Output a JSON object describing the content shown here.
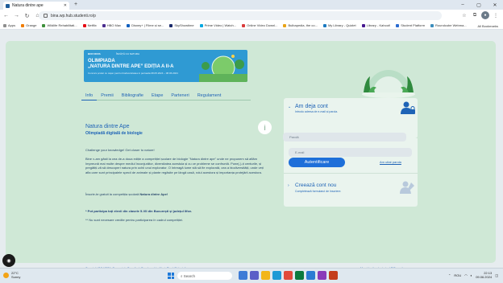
{
  "browser": {
    "tab_title": "Natura dintre ape",
    "new_tab": "+",
    "url": "bina.wp.hub.studenti.ro/p",
    "bookmarks": [
      "Apps",
      "Orange",
      "Wildlife Rehabilitati...",
      "Netflix",
      "HBO Max",
      "Disney+ | Filme și se...",
      "SkyShowtime",
      "Prime Video | Watch...",
      "Online Video Downl...",
      "Bulbapedia, the co...",
      "My Library - Quizlet",
      "Library - Kahoot!",
      "Student Platform",
      "Roundcube Webma..."
    ],
    "all_bookmarks": "All Bookmarks"
  },
  "banner": {
    "brand_left": "BCR NOVA",
    "brand_right": "ÎNVĂȚĂ CU NATURA",
    "title_line1": "OLIMPIADA",
    "title_line2": "„NATURA DINTRE APE” EDIȚIA A II-A",
    "subtitle": "Concurs școlar cu caper pentru biodiversitatea in perioada 08.05.2024 – 08.06.2024"
  },
  "nav": {
    "tabs": [
      "Info",
      "Premii",
      "Bibliografie",
      "Etape",
      "Parteneri",
      "Regulament"
    ],
    "active": 0
  },
  "content": {
    "title": "Natura dintre Ape",
    "subtitle": "Olimpiadă digitală de biologie",
    "tagline": "Challenge your knowledge! Get closer to nature!",
    "para1": "Bine v-am găsit la cea de-a doua ediție a competiției școlare de biologie \"Natura dintre ape\" unde ne propunem să aflăm împreună mai multe despre mediul înconjurător, diversitatea acestuia și cu ce probleme se confruntă. Pune(-)-ți centurile, și pregătiți-vă să descoperi natura prin ochii unui explorator. O întreagă lume stă să fie explorată, cea a biodiversității, unde veți afla care sunt principalele specii de animale și plante regăsite pe lângă casă, rolul acestora și importanța protejării acestora.",
    "register_prefix": "Înscrie-te gratuit la competiția școlară ",
    "register_bold": "Natura dintre Ape!",
    "note1": "* Pot participa toți elevii din clasele 5-VII din București și județul Ilfov.",
    "note2": "** Nu sunt necesare credite pentru participarea în cadrul competiției.",
    "info_icon": "i"
  },
  "login": {
    "title": "Am deja cont",
    "subtitle": "Introdu adresa de e-mail și parola.",
    "email_placeholder": "E-mail",
    "password_placeholder": "Parolă",
    "submit": "Autentificare",
    "forgot": "Am uitat parola"
  },
  "register": {
    "title": "Creează cont nou",
    "subtitle": "Completează formularul de înscriere."
  },
  "footer": {
    "left": "Copyright BAV 2024. Concept de Brandient. Developed by MagicPixel. Biologică",
    "right": "Mergi la sita-ul principal BIOapa ⊕"
  },
  "taskbar": {
    "temp": "22°C",
    "weather": "Sunny",
    "search": "Search",
    "lang": "ROU",
    "time": "22:13",
    "date": "09.06.2024"
  },
  "colors": {
    "accent": "#1e63b6",
    "card_bg": "#cfe8d6",
    "button": "#1e6fd9",
    "banner": "#2f9ad3"
  }
}
